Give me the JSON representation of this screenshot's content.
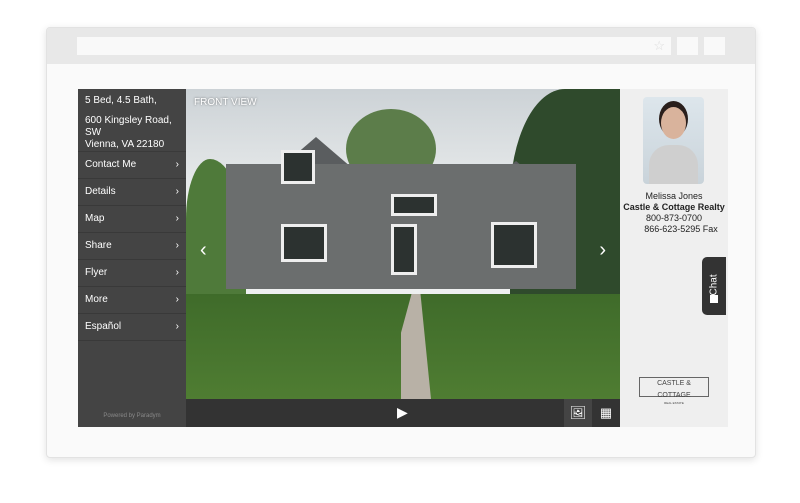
{
  "listing": {
    "beds_baths": "5 Bed, 4.5 Bath,",
    "address_line1": "600 Kingsley Road, SW",
    "address_line2": "Vienna, VA 22180"
  },
  "menu": [
    {
      "label": "Contact Me"
    },
    {
      "label": "Details"
    },
    {
      "label": "Map"
    },
    {
      "label": "Share"
    },
    {
      "label": "Flyer"
    },
    {
      "label": "More"
    },
    {
      "label": "Español"
    }
  ],
  "powered_by": "Powered by Paradym",
  "photo": {
    "caption": "FRONT VIEW"
  },
  "agent": {
    "name": "Melissa Jones",
    "company": "Castle & Cottage Realty",
    "phone": "800-873-0700",
    "fax": "866-623-5295 Fax"
  },
  "chat_label": "Chat",
  "logo": {
    "name": "CASTLE & COTTAGE",
    "tagline": "REAL ESTATE"
  },
  "colors": {
    "sidebar": "#444444",
    "control_bar": "#333333",
    "panel": "#efefef"
  }
}
